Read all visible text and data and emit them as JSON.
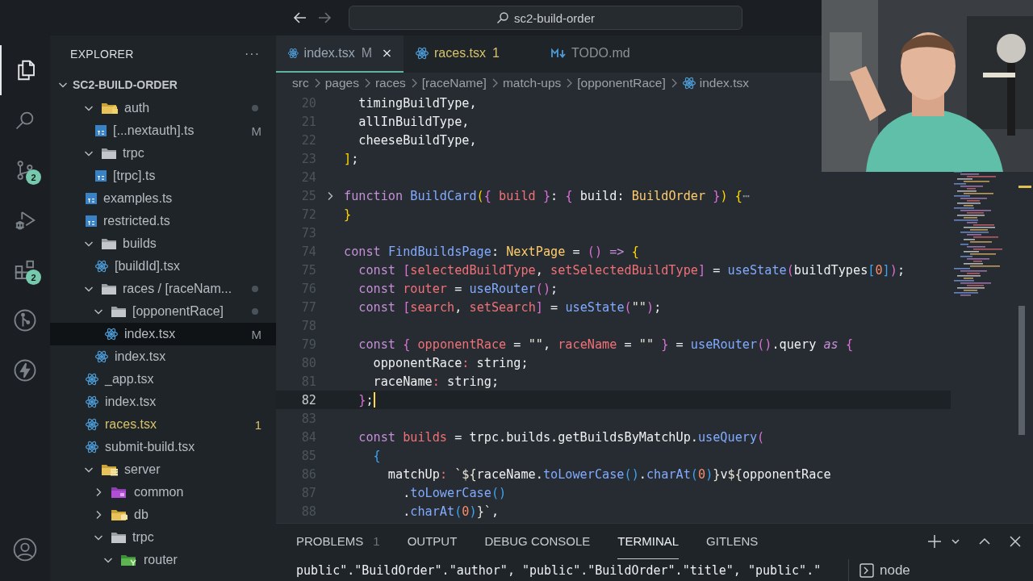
{
  "title_bar": {
    "search": "sc2-build-order"
  },
  "activity_bar": [
    {
      "kind": "explorer",
      "selected": true
    },
    {
      "kind": "search",
      "selected": false
    },
    {
      "kind": "source-control",
      "selected": false,
      "badge": "2"
    },
    {
      "kind": "debug",
      "selected": false
    },
    {
      "kind": "extensions",
      "selected": false,
      "badge": "2"
    },
    {
      "kind": "gitlens",
      "selected": false
    },
    {
      "kind": "bolt",
      "selected": false
    },
    {
      "kind": "account",
      "selected": false
    }
  ],
  "explorer": {
    "title": "EXPLORER",
    "more": "···",
    "root": {
      "label": "SC2-BUILD-ORDER",
      "expanded": true,
      "children": [
        {
          "label": "auth",
          "kind": "folder-lock",
          "expanded": true,
          "modified": true,
          "children": [
            {
              "label": "[...nextauth].ts",
              "kind": "ts",
              "selected": false,
              "decoration": {
                "text": "M",
                "kind": "modified"
              }
            }
          ]
        },
        {
          "label": "trpc",
          "kind": "folder",
          "expanded": true,
          "modified": false,
          "children": [
            {
              "label": "[trpc].ts",
              "kind": "ts",
              "selected": false
            }
          ]
        },
        {
          "label": "examples.ts",
          "kind": "ts",
          "selected": false
        },
        {
          "label": "restricted.ts",
          "kind": "ts",
          "selected": false
        },
        {
          "label": "builds",
          "kind": "folder",
          "expanded": true,
          "modified": false,
          "children": [
            {
              "label": "[buildId].tsx",
              "kind": "react",
              "selected": false
            }
          ]
        },
        {
          "label": "races / [raceNam...",
          "kind": "folder",
          "expanded": true,
          "modified": true,
          "children": [
            {
              "label": "[opponentRace]",
              "kind": "folder",
              "expanded": true,
              "modified": true,
              "children": [
                {
                  "label": "index.tsx",
                  "kind": "react",
                  "selected": true,
                  "decoration": {
                    "text": "M",
                    "kind": "modified"
                  }
                }
              ]
            },
            {
              "label": "index.tsx",
              "kind": "react",
              "selected": false
            }
          ]
        },
        {
          "label": "_app.tsx",
          "kind": "react",
          "selected": false
        },
        {
          "label": "index.tsx",
          "kind": "react",
          "selected": false
        },
        {
          "label": "races.tsx",
          "kind": "react",
          "selected": false,
          "decoration": {
            "text": "1",
            "kind": "error"
          }
        },
        {
          "label": "submit-build.tsx",
          "kind": "react",
          "selected": false
        },
        {
          "label": "server",
          "kind": "folder-server",
          "expanded": true,
          "modified": false,
          "children": [
            {
              "label": "common",
              "kind": "folder-purple",
              "expanded": false,
              "modified": false
            },
            {
              "label": "db",
              "kind": "folder-db",
              "expanded": false,
              "modified": false
            },
            {
              "label": "trpc",
              "kind": "folder",
              "expanded": true,
              "modified": false,
              "children": [
                {
                  "label": "router",
                  "kind": "folder-router",
                  "expanded": true,
                  "modified": false
                }
              ]
            }
          ]
        }
      ]
    }
  },
  "editor": {
    "tabs": [
      {
        "label": "index.tsx",
        "kind": "react",
        "selected": true,
        "decoration": {
          "text": "M",
          "kind": "modified"
        }
      },
      {
        "label": "races.tsx",
        "kind": "react",
        "selected": false,
        "decoration": {
          "text": "1",
          "kind": "error"
        }
      },
      {
        "label": "TODO.md",
        "kind": "markdown",
        "selected": false
      }
    ],
    "breadcrumbs": [
      {
        "label": "src"
      },
      {
        "label": "pages"
      },
      {
        "label": "races"
      },
      {
        "label": "[raceName]"
      },
      {
        "label": "match-ups"
      },
      {
        "label": "[opponentRace]"
      },
      {
        "label": "index.tsx",
        "kind": "react"
      }
    ],
    "lines": [
      {
        "number": "20",
        "selected": false,
        "tokens": [
          {
            "text": "  timingBuildType,",
            "kind": "plain"
          }
        ]
      },
      {
        "number": "21",
        "selected": false,
        "tokens": [
          {
            "text": "  allInBuildType,",
            "kind": "plain"
          }
        ]
      },
      {
        "number": "22",
        "selected": false,
        "tokens": [
          {
            "text": "  cheeseBuildType,",
            "kind": "plain"
          }
        ]
      },
      {
        "number": "23",
        "selected": false,
        "tokens": [
          {
            "text": "]",
            "kind": "bracket1"
          },
          {
            "text": ";",
            "kind": "plain"
          }
        ]
      },
      {
        "number": "24",
        "selected": false
      },
      {
        "number": "25",
        "selected": false,
        "folded": true,
        "tokens": [
          {
            "text": "function ",
            "kind": "keyword"
          },
          {
            "text": "BuildCard",
            "kind": "function"
          },
          {
            "text": "(",
            "kind": "bracket1"
          },
          {
            "text": "{",
            "kind": "bracket2"
          },
          {
            "text": " build ",
            "kind": "variable"
          },
          {
            "text": "}",
            "kind": "bracket2"
          },
          {
            "text": ": ",
            "kind": "plain"
          },
          {
            "text": "{",
            "kind": "bracket2"
          },
          {
            "text": " build: ",
            "kind": "plain"
          },
          {
            "text": "BuildOrder",
            "kind": "type"
          },
          {
            "text": " }",
            "kind": "bracket2"
          },
          {
            "text": ")",
            "kind": "bracket1"
          },
          {
            "text": " {",
            "kind": "bracket1"
          },
          {
            "text": "⋯",
            "kind": "muted"
          }
        ]
      },
      {
        "number": "72",
        "selected": false,
        "tokens": [
          {
            "text": "}",
            "kind": "bracket1"
          }
        ]
      },
      {
        "number": "73",
        "selected": false
      },
      {
        "number": "74",
        "selected": false,
        "tokens": [
          {
            "text": "const ",
            "kind": "keyword"
          },
          {
            "text": "FindBuildsPage",
            "kind": "function"
          },
          {
            "text": ": ",
            "kind": "plain"
          },
          {
            "text": "NextPage",
            "kind": "type"
          },
          {
            "text": " = ",
            "kind": "plain"
          },
          {
            "text": "()",
            "kind": "bracket2"
          },
          {
            "text": " => ",
            "kind": "keyword"
          },
          {
            "text": "{",
            "kind": "bracket1"
          }
        ]
      },
      {
        "number": "75",
        "selected": false,
        "tokens": [
          {
            "text": "  const ",
            "kind": "keyword"
          },
          {
            "text": "[",
            "kind": "bracket2"
          },
          {
            "text": "selectedBuildType",
            "kind": "variable"
          },
          {
            "text": ", ",
            "kind": "plain"
          },
          {
            "text": "setSelectedBuildType",
            "kind": "variable"
          },
          {
            "text": "]",
            "kind": "bracket2"
          },
          {
            "text": " = ",
            "kind": "plain"
          },
          {
            "text": "useState",
            "kind": "function"
          },
          {
            "text": "(",
            "kind": "bracket2"
          },
          {
            "text": "buildTypes",
            "kind": "plain"
          },
          {
            "text": "[",
            "kind": "bracket3"
          },
          {
            "text": "0",
            "kind": "number"
          },
          {
            "text": "]",
            "kind": "bracket3"
          },
          {
            "text": ")",
            "kind": "bracket2"
          },
          {
            "text": ";",
            "kind": "plain"
          }
        ]
      },
      {
        "number": "76",
        "selected": false,
        "tokens": [
          {
            "text": "  const ",
            "kind": "keyword"
          },
          {
            "text": "router",
            "kind": "variable"
          },
          {
            "text": " = ",
            "kind": "plain"
          },
          {
            "text": "useRouter",
            "kind": "function"
          },
          {
            "text": "()",
            "kind": "bracket2"
          },
          {
            "text": ";",
            "kind": "plain"
          }
        ]
      },
      {
        "number": "77",
        "selected": false,
        "tokens": [
          {
            "text": "  const ",
            "kind": "keyword"
          },
          {
            "text": "[",
            "kind": "bracket2"
          },
          {
            "text": "search",
            "kind": "variable"
          },
          {
            "text": ", ",
            "kind": "plain"
          },
          {
            "text": "setSearch",
            "kind": "variable"
          },
          {
            "text": "]",
            "kind": "bracket2"
          },
          {
            "text": " = ",
            "kind": "plain"
          },
          {
            "text": "useState",
            "kind": "function"
          },
          {
            "text": "(",
            "kind": "bracket2"
          },
          {
            "text": "\"\"",
            "kind": "string"
          },
          {
            "text": ")",
            "kind": "bracket2"
          },
          {
            "text": ";",
            "kind": "plain"
          }
        ]
      },
      {
        "number": "78",
        "selected": false
      },
      {
        "number": "79",
        "selected": false,
        "tokens": [
          {
            "text": "  const ",
            "kind": "keyword"
          },
          {
            "text": "{",
            "kind": "bracket2"
          },
          {
            "text": " opponentRace",
            "kind": "variable"
          },
          {
            "text": " = ",
            "kind": "plain"
          },
          {
            "text": "\"\"",
            "kind": "string"
          },
          {
            "text": ", ",
            "kind": "plain"
          },
          {
            "text": "raceName",
            "kind": "variable"
          },
          {
            "text": " = ",
            "kind": "plain"
          },
          {
            "text": "\"\"",
            "kind": "string"
          },
          {
            "text": " }",
            "kind": "bracket2"
          },
          {
            "text": " = ",
            "kind": "plain"
          },
          {
            "text": "useRouter",
            "kind": "function"
          },
          {
            "text": "()",
            "kind": "bracket2"
          },
          {
            "text": ".query ",
            "kind": "plain"
          },
          {
            "text": "as ",
            "kind": "italic"
          },
          {
            "text": "{",
            "kind": "bracket2"
          }
        ]
      },
      {
        "number": "80",
        "selected": false,
        "tokens": [
          {
            "text": "    opponentRace",
            "kind": "plain"
          },
          {
            "text": ":",
            "kind": "variable"
          },
          {
            "text": " string;",
            "kind": "plain"
          }
        ]
      },
      {
        "number": "81",
        "selected": false,
        "tokens": [
          {
            "text": "    raceName",
            "kind": "plain"
          },
          {
            "text": ":",
            "kind": "variable"
          },
          {
            "text": " string;",
            "kind": "plain"
          }
        ]
      },
      {
        "number": "82",
        "selected": true,
        "tokens": [
          {
            "text": "  }",
            "kind": "bracket2"
          },
          {
            "text": ";",
            "kind": "plain"
          }
        ]
      },
      {
        "number": "83",
        "selected": false
      },
      {
        "number": "84",
        "selected": false,
        "tokens": [
          {
            "text": "  const ",
            "kind": "keyword"
          },
          {
            "text": "builds",
            "kind": "variable"
          },
          {
            "text": " = ",
            "kind": "plain"
          },
          {
            "text": "trpc.builds.getBuildsByMatchUp.",
            "kind": "plain"
          },
          {
            "text": "useQuery",
            "kind": "function"
          },
          {
            "text": "(",
            "kind": "bracket2"
          }
        ]
      },
      {
        "number": "85",
        "selected": false,
        "tokens": [
          {
            "text": "    {",
            "kind": "bracket3"
          }
        ]
      },
      {
        "number": "86",
        "selected": false,
        "tokens": [
          {
            "text": "      matchUp",
            "kind": "plain"
          },
          {
            "text": ": ",
            "kind": "variable"
          },
          {
            "text": "`${",
            "kind": "string"
          },
          {
            "text": "raceName.",
            "kind": "plain"
          },
          {
            "text": "toLowerCase",
            "kind": "function"
          },
          {
            "text": "()",
            "kind": "bracket3"
          },
          {
            "text": ".",
            "kind": "plain"
          },
          {
            "text": "charAt",
            "kind": "function"
          },
          {
            "text": "(",
            "kind": "bracket3"
          },
          {
            "text": "0",
            "kind": "number"
          },
          {
            "text": ")",
            "kind": "bracket3"
          },
          {
            "text": "}",
            "kind": "string"
          },
          {
            "text": "v",
            "kind": "plain"
          },
          {
            "text": "${",
            "kind": "string"
          },
          {
            "text": "opponentRace",
            "kind": "plain"
          }
        ]
      },
      {
        "number": "87",
        "selected": false,
        "tokens": [
          {
            "text": "        .",
            "kind": "plain"
          },
          {
            "text": "toLowerCase",
            "kind": "function"
          },
          {
            "text": "()",
            "kind": "bracket3"
          }
        ]
      },
      {
        "number": "88",
        "selected": false,
        "tokens": [
          {
            "text": "        .",
            "kind": "plain"
          },
          {
            "text": "charAt",
            "kind": "function"
          },
          {
            "text": "(",
            "kind": "bracket3"
          },
          {
            "text": "0",
            "kind": "number"
          },
          {
            "text": ")",
            "kind": "bracket3"
          },
          {
            "text": "}`",
            "kind": "string"
          },
          {
            "text": ",",
            "kind": "plain"
          }
        ]
      }
    ]
  },
  "panel": {
    "tabs": [
      {
        "label": "PROBLEMS",
        "selected": false,
        "badge": "1"
      },
      {
        "label": "OUTPUT",
        "selected": false
      },
      {
        "label": "DEBUG CONSOLE",
        "selected": false
      },
      {
        "label": "TERMINAL",
        "selected": true
      },
      {
        "label": "GITLENS",
        "selected": false
      }
    ],
    "terminal_output": "public\".\"BuildOrder\".\"author\", \"public\".\"BuildOrder\".\"title\", \"public\".\"",
    "terminals": [
      {
        "label": "node"
      }
    ]
  }
}
